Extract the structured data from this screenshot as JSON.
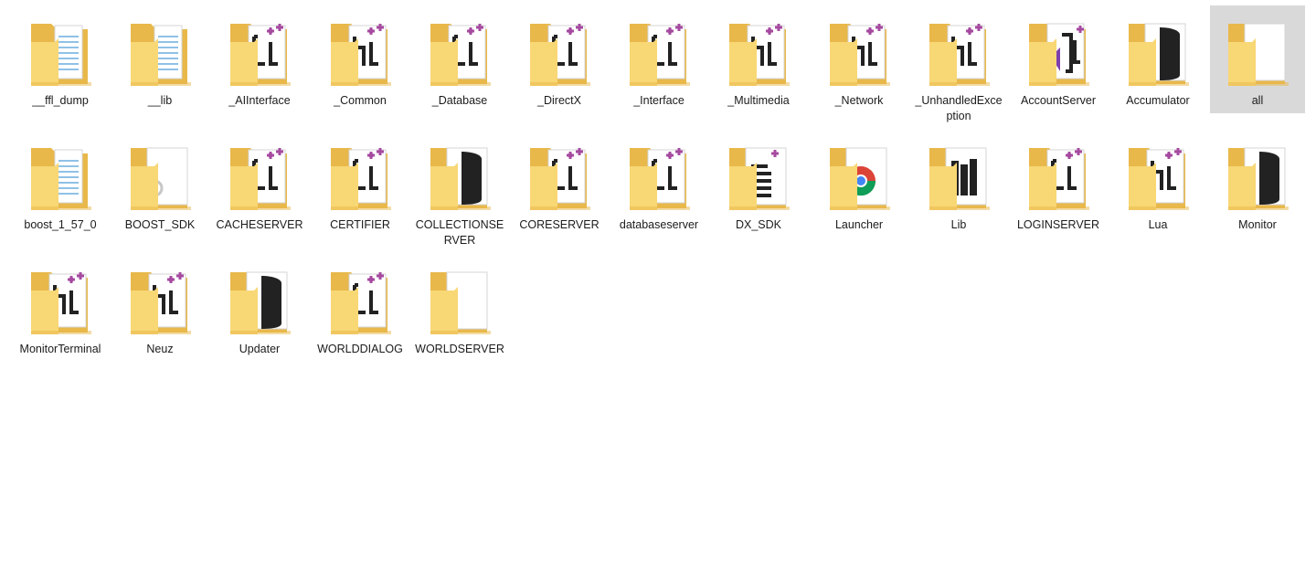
{
  "folder_view": {
    "items": [
      {
        "label": "__ffl_dump",
        "icon": "folder-docs-icon",
        "overlay": "doc"
      },
      {
        "label": "__lib",
        "icon": "folder-docs-icon",
        "overlay": "doc"
      },
      {
        "label": "_AIInterface",
        "icon": "folder-cpp-icon",
        "overlay": "cpp"
      },
      {
        "label": "_Common",
        "icon": "folder-h-icon",
        "overlay": "h"
      },
      {
        "label": "_Database",
        "icon": "folder-cpp-icon",
        "overlay": "cpp"
      },
      {
        "label": "_DirectX",
        "icon": "folder-cpp-icon",
        "overlay": "cpp"
      },
      {
        "label": "_Interface",
        "icon": "folder-cpp-icon",
        "overlay": "cpp"
      },
      {
        "label": "_Multimedia",
        "icon": "folder-h-icon",
        "overlay": "h"
      },
      {
        "label": "_Network",
        "icon": "folder-h-icon",
        "overlay": "h"
      },
      {
        "label": "_UnhandledException",
        "icon": "folder-h-icon",
        "overlay": "h"
      },
      {
        "label": "AccountServer",
        "icon": "folder-vs-icon",
        "overlay": "vs"
      },
      {
        "label": "Accumulator",
        "icon": "folder-db-icon",
        "overlay": "db"
      },
      {
        "label": "all",
        "icon": "folder-empty-icon",
        "overlay": "blank",
        "selected": true
      },
      {
        "label": "boost_1_57_0",
        "icon": "folder-docs-icon",
        "overlay": "doc"
      },
      {
        "label": "BOOST_SDK",
        "icon": "folder-gear-icon",
        "overlay": "gear"
      },
      {
        "label": "CACHESERVER",
        "icon": "folder-cpp-icon",
        "overlay": "cpp"
      },
      {
        "label": "CERTIFIER",
        "icon": "folder-cpp-icon",
        "overlay": "cpp"
      },
      {
        "label": "COLLECTIONSERVER",
        "icon": "folder-db-icon",
        "overlay": "db"
      },
      {
        "label": "CORESERVER",
        "icon": "folder-cpp-icon",
        "overlay": "cpp"
      },
      {
        "label": "databaseserver",
        "icon": "folder-cpp-icon",
        "overlay": "cpp"
      },
      {
        "label": "DX_SDK",
        "icon": "folder-text-icon",
        "overlay": "text"
      },
      {
        "label": "Launcher",
        "icon": "folder-chrome-icon",
        "overlay": "chrome"
      },
      {
        "label": "Lib",
        "icon": "folder-lib-icon",
        "overlay": "lib"
      },
      {
        "label": "LOGINSERVER",
        "icon": "folder-cpp-icon",
        "overlay": "cpp"
      },
      {
        "label": "Lua",
        "icon": "folder-h-icon",
        "overlay": "h"
      },
      {
        "label": "Monitor",
        "icon": "folder-db-icon",
        "overlay": "db"
      },
      {
        "label": "MonitorTerminal",
        "icon": "folder-h-icon",
        "overlay": "h"
      },
      {
        "label": "Neuz",
        "icon": "folder-h-icon",
        "overlay": "h"
      },
      {
        "label": "Updater",
        "icon": "folder-db-icon",
        "overlay": "db"
      },
      {
        "label": "WORLDDIALOG",
        "icon": "folder-cpp-icon",
        "overlay": "cpp"
      },
      {
        "label": "WORLDSERVER",
        "icon": "folder-empty-icon",
        "overlay": "blank"
      }
    ]
  },
  "colors": {
    "folder_back": "#e8b84a",
    "folder_front": "#f8d775",
    "paper": "#ffffff",
    "ink": "#222222",
    "plus": "#a64aa0",
    "selection": "#d9d9d9"
  }
}
